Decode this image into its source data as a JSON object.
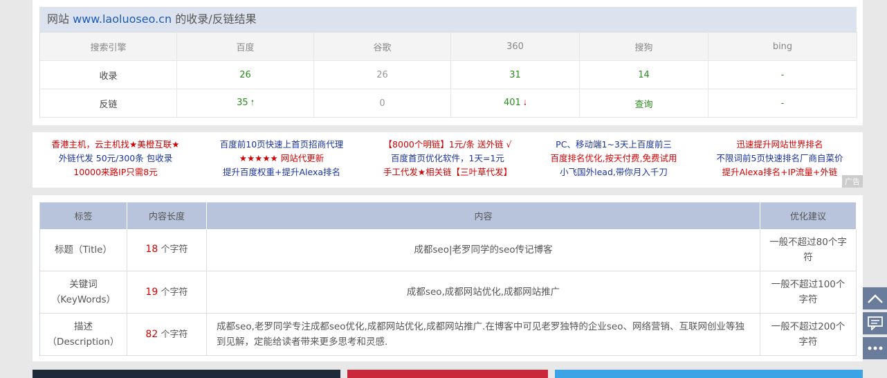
{
  "result_header": {
    "prefix": "网站",
    "domain": "www.laoluoseo.cn",
    "suffix": "的收录/反链结果"
  },
  "engines_table": {
    "headers": [
      "搜索引擎",
      "百度",
      "谷歌",
      "360",
      "搜狗",
      "bing"
    ],
    "rows": [
      {
        "label": "收录",
        "values": [
          "26",
          "26",
          "31",
          "14",
          "-"
        ]
      },
      {
        "label": "反链",
        "values": [
          "35",
          "0",
          "401",
          "查询",
          "-"
        ]
      }
    ]
  },
  "ads": [
    {
      "lines": [
        "香港主机，云主机找★美橙互联★",
        "外链代发 50元/300条 包收录",
        "10000来路IP只需8元"
      ],
      "colors": [
        "#d40000",
        "#1a33a0",
        "#d40000"
      ]
    },
    {
      "lines": [
        "百度前10页快速上首页招商代理",
        "★★★★★ 网站代更新",
        "提升百度权重+提升Alexa排名"
      ],
      "colors": [
        "#1a33a0",
        "#d40000",
        "#1a33a0"
      ]
    },
    {
      "lines": [
        "【8000个明链】1元/条 送外链 √",
        "百度首页优化软件，1天=1元",
        "手工代发★相关链【三叶草代发】"
      ],
      "colors": [
        "#d40000",
        "#1a33a0",
        "#d40000"
      ]
    },
    {
      "lines": [
        "PC、移动端1~3天上百度前三",
        "百度排名优化,按天付费,免费试用",
        "小飞国外lead,带你月入千刀"
      ],
      "colors": [
        "#1a33a0",
        "#d40000",
        "#1a33a0"
      ]
    },
    {
      "lines": [
        "迅速提升网站世界排名",
        "不限词前5页快速排名厂商自菜价",
        "提升Alexa排名+IP流量+外链"
      ],
      "colors": [
        "#d40000",
        "#1a33a0",
        "#d40000"
      ]
    }
  ],
  "ad_badge": "广告",
  "meta_table": {
    "headers": [
      "标签",
      "内容长度",
      "内容",
      "优化建议"
    ],
    "rows": [
      {
        "tag": "标题（Title）",
        "length": "18",
        "unit": "个字符",
        "content": "成都seo|老罗同学的seo传记博客",
        "advice": "一般不超过80个字符"
      },
      {
        "tag": "关键词（KeyWords）",
        "length": "19",
        "unit": "个字符",
        "content": "成都seo,成都网站优化,成都网站推广",
        "advice": "一般不超过100个字符"
      },
      {
        "tag": "描述（Description）",
        "length": "82",
        "unit": "个字符",
        "content": "成都seo,老罗同学专注成都seo优化,成都网站优化,成都网站推广.在博客中可见老罗独特的企业seo、网络营销、互联网创业等独到见解，定能给读者带来更多思考和灵感.",
        "advice": "一般不超过200个字符"
      }
    ]
  }
}
